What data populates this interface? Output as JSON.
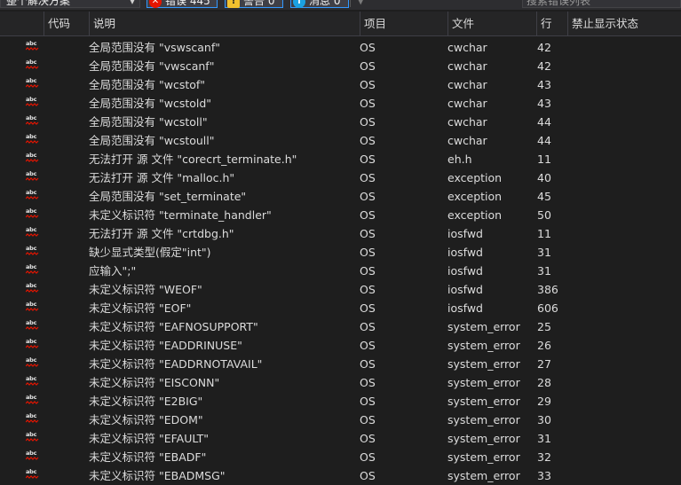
{
  "toolbar": {
    "scope": "整个解决方案",
    "errors": {
      "label": "错误 445",
      "color": "#e51400"
    },
    "warnings": {
      "label": "警告 0",
      "color": "#f2c12e"
    },
    "messages": {
      "label": "消息 0",
      "color": "#1ba1e2"
    },
    "search_placeholder": "搜索错误列表"
  },
  "columns": {
    "code": "代码",
    "description": "说明",
    "project": "项目",
    "file": "文件",
    "line": "行",
    "suppression": "禁止显示状态"
  },
  "row_icon_text": "abc",
  "rows": [
    {
      "desc": "全局范围没有 \"vswscanf\"",
      "project": "OS",
      "file": "cwchar",
      "line": "42"
    },
    {
      "desc": "全局范围没有 \"vwscanf\"",
      "project": "OS",
      "file": "cwchar",
      "line": "42"
    },
    {
      "desc": "全局范围没有 \"wcstof\"",
      "project": "OS",
      "file": "cwchar",
      "line": "43"
    },
    {
      "desc": "全局范围没有 \"wcstold\"",
      "project": "OS",
      "file": "cwchar",
      "line": "43"
    },
    {
      "desc": "全局范围没有 \"wcstoll\"",
      "project": "OS",
      "file": "cwchar",
      "line": "44"
    },
    {
      "desc": "全局范围没有 \"wcstoull\"",
      "project": "OS",
      "file": "cwchar",
      "line": "44"
    },
    {
      "desc": "无法打开 源 文件 \"corecrt_terminate.h\"",
      "project": "OS",
      "file": "eh.h",
      "line": "11"
    },
    {
      "desc": "无法打开 源 文件 \"malloc.h\"",
      "project": "OS",
      "file": "exception",
      "line": "40"
    },
    {
      "desc": "全局范围没有 \"set_terminate\"",
      "project": "OS",
      "file": "exception",
      "line": "45"
    },
    {
      "desc": "未定义标识符 \"terminate_handler\"",
      "project": "OS",
      "file": "exception",
      "line": "50"
    },
    {
      "desc": "无法打开 源 文件 \"crtdbg.h\"",
      "project": "OS",
      "file": "iosfwd",
      "line": "11"
    },
    {
      "desc": "缺少显式类型(假定\"int\")",
      "project": "OS",
      "file": "iosfwd",
      "line": "31"
    },
    {
      "desc": "应输入\";\"",
      "project": "OS",
      "file": "iosfwd",
      "line": "31"
    },
    {
      "desc": "未定义标识符 \"WEOF\"",
      "project": "OS",
      "file": "iosfwd",
      "line": "386"
    },
    {
      "desc": "未定义标识符 \"EOF\"",
      "project": "OS",
      "file": "iosfwd",
      "line": "606"
    },
    {
      "desc": "未定义标识符 \"EAFNOSUPPORT\"",
      "project": "OS",
      "file": "system_error",
      "line": "25"
    },
    {
      "desc": "未定义标识符 \"EADDRINUSE\"",
      "project": "OS",
      "file": "system_error",
      "line": "26"
    },
    {
      "desc": "未定义标识符 \"EADDRNOTAVAIL\"",
      "project": "OS",
      "file": "system_error",
      "line": "27"
    },
    {
      "desc": "未定义标识符 \"EISCONN\"",
      "project": "OS",
      "file": "system_error",
      "line": "28"
    },
    {
      "desc": "未定义标识符 \"E2BIG\"",
      "project": "OS",
      "file": "system_error",
      "line": "29"
    },
    {
      "desc": "未定义标识符 \"EDOM\"",
      "project": "OS",
      "file": "system_error",
      "line": "30"
    },
    {
      "desc": "未定义标识符 \"EFAULT\"",
      "project": "OS",
      "file": "system_error",
      "line": "31"
    },
    {
      "desc": "未定义标识符 \"EBADF\"",
      "project": "OS",
      "file": "system_error",
      "line": "32"
    },
    {
      "desc": "未定义标识符 \"EBADMSG\"",
      "project": "OS",
      "file": "system_error",
      "line": "33"
    }
  ]
}
